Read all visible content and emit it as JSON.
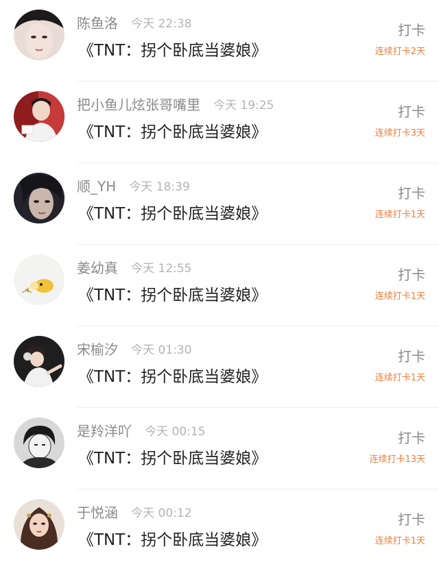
{
  "colors": {
    "username": "#8a8a8a",
    "time": "#b3b3b3",
    "title": "#222222",
    "streak": "#f07d3a",
    "divider": "#eeeeee"
  },
  "posts": [
    {
      "username": "陈鱼洛",
      "time": "今天 22:38",
      "title": "《TNT：拐个卧底当婆娘》",
      "checkin_label": "打卡",
      "streak": "连续打卡2天",
      "avatar_icon": "user-avatar"
    },
    {
      "username": "把小鱼儿炫张哥嘴里",
      "time": "今天 19:25",
      "title": "《TNT：拐个卧底当婆娘》",
      "checkin_label": "打卡",
      "streak": "连续打卡3天",
      "avatar_icon": "user-avatar"
    },
    {
      "username": "顺_YH",
      "time": "今天 18:39",
      "title": "《TNT：拐个卧底当婆娘》",
      "checkin_label": "打卡",
      "streak": "连续打卡1天",
      "avatar_icon": "user-avatar"
    },
    {
      "username": "姜幼真",
      "time": "今天 12:55",
      "title": "《TNT：拐个卧底当婆娘》",
      "checkin_label": "打卡",
      "streak": "连续打卡1天",
      "avatar_icon": "user-avatar"
    },
    {
      "username": "宋榆汐",
      "time": "今天 01:30",
      "title": "《TNT：拐个卧底当婆娘》",
      "checkin_label": "打卡",
      "streak": "连续打卡1天",
      "avatar_icon": "user-avatar"
    },
    {
      "username": "是羚洋吖",
      "time": "今天 00:15",
      "title": "《TNT：拐个卧底当婆娘》",
      "checkin_label": "打卡",
      "streak": "连续打卡13天",
      "avatar_icon": "user-avatar"
    },
    {
      "username": "于悦涵",
      "time": "今天 00:12",
      "title": "《TNT：拐个卧底当婆娘》",
      "checkin_label": "打卡",
      "streak": "连续打卡1天",
      "avatar_icon": "user-avatar"
    }
  ]
}
